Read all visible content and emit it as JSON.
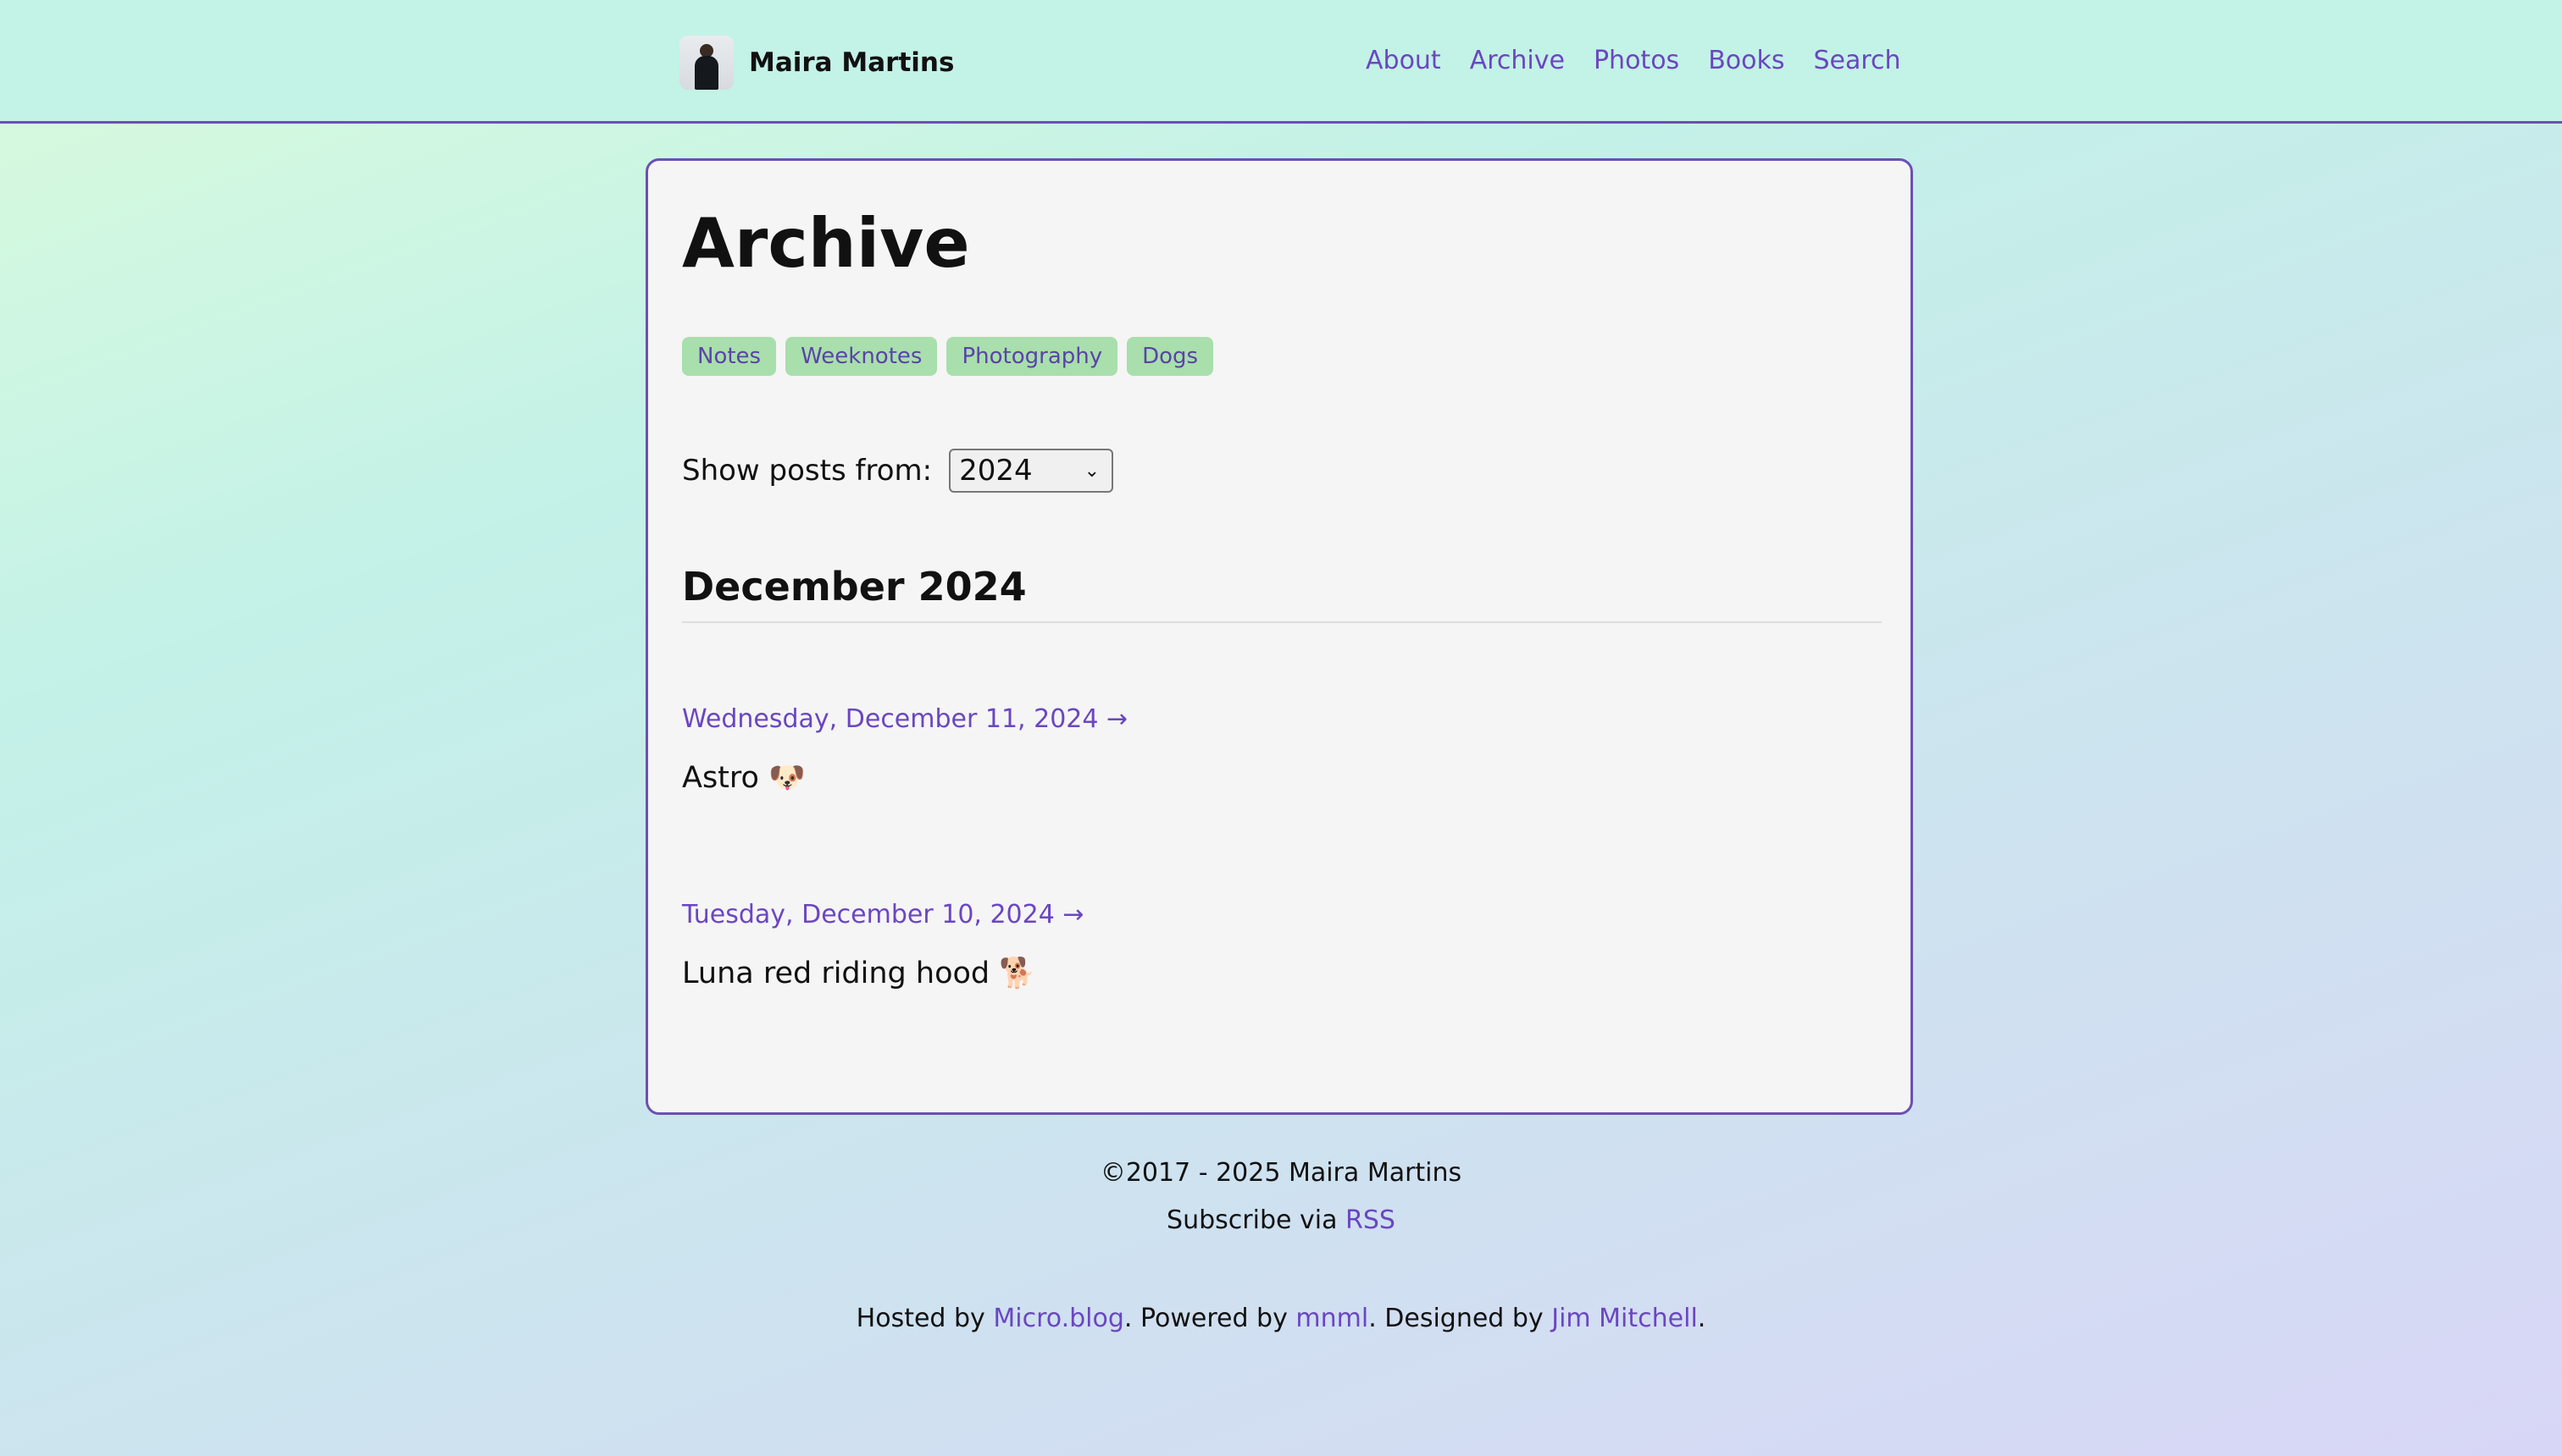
{
  "header": {
    "site_name": "Maira Martins",
    "nav": [
      "About",
      "Archive",
      "Photos",
      "Books",
      "Search"
    ]
  },
  "main": {
    "title": "Archive",
    "tags": [
      "Notes",
      "Weeknotes",
      "Photography",
      "Dogs"
    ],
    "filter": {
      "label": "Show posts from:",
      "selected_year": "2024"
    },
    "month_heading": "December 2024",
    "posts": [
      {
        "date": "Wednesday, December 11, 2024 →",
        "text": "Astro 🐶"
      },
      {
        "date": "Tuesday, December 10, 2024 →",
        "text": "Luna red riding hood 🐕"
      }
    ]
  },
  "footer": {
    "copyright": "©2017 - 2025 Maira Martins",
    "subscribe_text": "Subscribe via",
    "rss_link": "RSS",
    "hosted_by": "Hosted by",
    "host_link": "Micro.blog",
    "powered_by": ". Powered by",
    "theme_link": "mnml",
    "designed_by": ". Designed by",
    "designer_link": "Jim Mitchell",
    "end": "."
  },
  "colors": {
    "accent": "#6b46c1",
    "header_bg": "#c3f2e7",
    "card_bg": "#f5f5f5",
    "tag_bg": "#a8dfac",
    "border": "#6b50b3"
  },
  "icons": {
    "avatar": "profile-photo",
    "select_arrow": "chevron-down-icon"
  }
}
